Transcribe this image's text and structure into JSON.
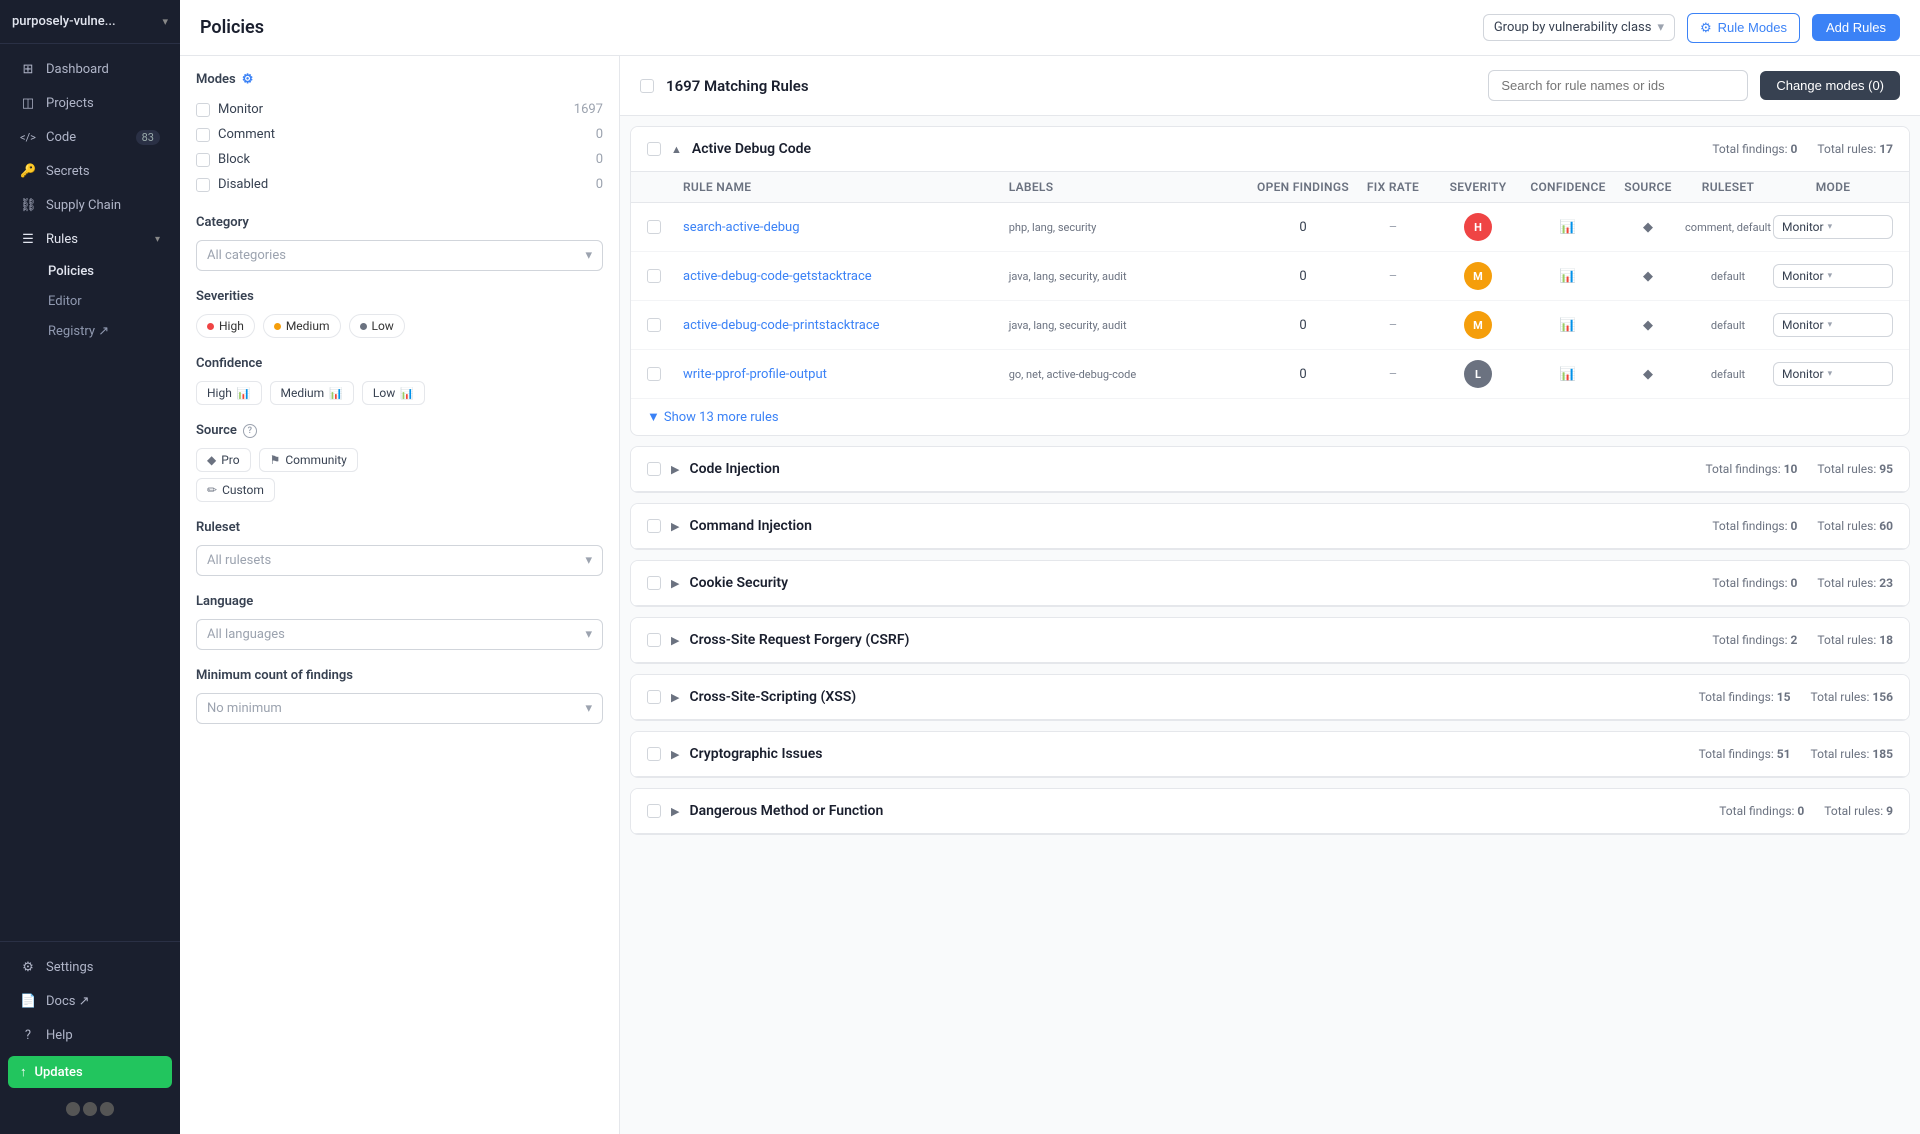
{
  "app": {
    "name": "purposely-vulne...",
    "chevron": "▾"
  },
  "sidebar": {
    "items": [
      {
        "id": "dashboard",
        "label": "Dashboard",
        "icon": "⊞",
        "badge": null
      },
      {
        "id": "projects",
        "label": "Projects",
        "icon": "◫",
        "badge": null
      },
      {
        "id": "code",
        "label": "Code",
        "icon": "</>",
        "badge": "83"
      },
      {
        "id": "secrets",
        "label": "Secrets",
        "icon": "🔑",
        "badge": null
      },
      {
        "id": "supply-chain",
        "label": "Supply Chain",
        "icon": "⛓",
        "badge": null
      },
      {
        "id": "rules",
        "label": "Rules",
        "icon": "☰",
        "badge": null
      }
    ],
    "sub_items": [
      {
        "id": "policies",
        "label": "Policies",
        "active": true
      },
      {
        "id": "editor",
        "label": "Editor",
        "active": false
      },
      {
        "id": "registry",
        "label": "Registry ↗",
        "active": false
      }
    ],
    "footer_items": [
      {
        "id": "settings",
        "label": "Settings",
        "icon": "⚙"
      },
      {
        "id": "docs",
        "label": "Docs ↗",
        "icon": "📄"
      },
      {
        "id": "help",
        "label": "Help",
        "icon": "?"
      }
    ],
    "updates": "Updates"
  },
  "topbar": {
    "title": "Policies",
    "group_by_label": "Group by vulnerability class",
    "btn_rule_modes": "Rule Modes",
    "btn_add_rules": "Add Rules"
  },
  "filters": {
    "modes_title": "Modes",
    "modes": [
      {
        "label": "Monitor",
        "count": "1697"
      },
      {
        "label": "Comment",
        "count": "0"
      },
      {
        "label": "Block",
        "count": "0"
      },
      {
        "label": "Disabled",
        "count": "0"
      }
    ],
    "category_title": "Category",
    "category_placeholder": "All categories",
    "severities_title": "Severities",
    "severities": [
      {
        "label": "High",
        "class": "high"
      },
      {
        "label": "Medium",
        "class": "medium"
      },
      {
        "label": "Low",
        "class": "low"
      }
    ],
    "confidence_title": "Confidence",
    "confidence": [
      {
        "label": "High",
        "icon": "📊"
      },
      {
        "label": "Medium",
        "icon": "📊"
      },
      {
        "label": "Low",
        "icon": "📊"
      }
    ],
    "source_title": "Source",
    "source_info": "?",
    "sources": [
      {
        "label": "Pro",
        "icon": "◆"
      },
      {
        "label": "Community",
        "icon": "⚑"
      },
      {
        "label": "Custom",
        "icon": "✏"
      }
    ],
    "ruleset_title": "Ruleset",
    "ruleset_placeholder": "All rulesets",
    "language_title": "Language",
    "language_placeholder": "All languages",
    "min_findings_title": "Minimum count of findings",
    "min_findings_placeholder": "No minimum"
  },
  "rules": {
    "count": "1697 Matching Rules",
    "search_placeholder": "Search for rule names or ids",
    "btn_change_modes": "Change modes (0)",
    "groups": [
      {
        "id": "active-debug-code",
        "name": "Active Debug Code",
        "expanded": true,
        "total_findings": 0,
        "total_rules": 17,
        "show_more": "Show 13 more rules",
        "rules": [
          {
            "id": "search-active-debug",
            "name": "search-active-debug",
            "labels": "php, lang, security",
            "open_findings": 0,
            "fix_rate": "–",
            "severity": "H",
            "sev_class": "sev-h",
            "confidence": "high",
            "source": "◆",
            "ruleset": "comment, default",
            "mode": "Monitor"
          },
          {
            "id": "active-debug-code-getstacktrace",
            "name": "active-debug-code-getstacktrace",
            "labels": "java, lang, security, audit",
            "open_findings": 0,
            "fix_rate": "–",
            "severity": "M",
            "sev_class": "sev-m",
            "confidence": "high",
            "source": "◆",
            "ruleset": "default",
            "mode": "Monitor"
          },
          {
            "id": "active-debug-code-printstacktrace",
            "name": "active-debug-code-printstacktrace",
            "labels": "java, lang, security, audit",
            "open_findings": 0,
            "fix_rate": "–",
            "severity": "M",
            "sev_class": "sev-m",
            "confidence": "high",
            "source": "◆",
            "ruleset": "default",
            "mode": "Monitor"
          },
          {
            "id": "write-pprof-profile-output",
            "name": "write-pprof-profile-output",
            "labels": "go, net, active-debug-code",
            "open_findings": 0,
            "fix_rate": "–",
            "severity": "L",
            "sev_class": "sev-l",
            "confidence": "high",
            "source": "◆",
            "ruleset": "default",
            "mode": "Monitor"
          }
        ]
      },
      {
        "id": "code-injection",
        "name": "Code Injection",
        "expanded": false,
        "total_findings": 10,
        "total_rules": 95
      },
      {
        "id": "command-injection",
        "name": "Command Injection",
        "expanded": false,
        "total_findings": 0,
        "total_rules": 60
      },
      {
        "id": "cookie-security",
        "name": "Cookie Security",
        "expanded": false,
        "total_findings": 0,
        "total_rules": 23
      },
      {
        "id": "csrf",
        "name": "Cross-Site Request Forgery (CSRF)",
        "expanded": false,
        "total_findings": 2,
        "total_rules": 18
      },
      {
        "id": "xss",
        "name": "Cross-Site-Scripting (XSS)",
        "expanded": false,
        "total_findings": 15,
        "total_rules": 156
      },
      {
        "id": "crypto",
        "name": "Cryptographic Issues",
        "expanded": false,
        "total_findings": 51,
        "total_rules": 185
      },
      {
        "id": "dangerous-method",
        "name": "Dangerous Method or Function",
        "expanded": false,
        "total_findings": 0,
        "total_rules": 9
      }
    ]
  }
}
